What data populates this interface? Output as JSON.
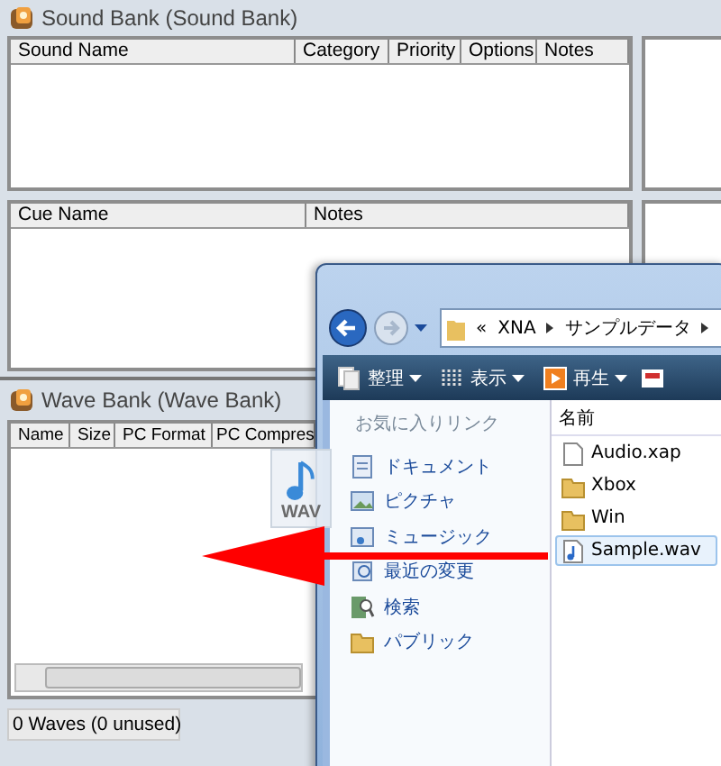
{
  "sound_bank": {
    "title": "Sound Bank (Sound Bank)",
    "sound_columns": [
      "Sound Name",
      "Category",
      "Priority",
      "Options",
      "Notes"
    ],
    "cue_columns": [
      "Cue Name",
      "Notes"
    ]
  },
  "wave_bank": {
    "title": "Wave Bank (Wave Bank)",
    "columns": [
      "Name",
      "Size",
      "PC Format",
      "PC Compres"
    ],
    "status": "0 Waves (0 unused)"
  },
  "explorer": {
    "breadcrumb": [
      "«",
      "XNA",
      "サンプルデータ"
    ],
    "toolbar": [
      {
        "label": "整理",
        "kind": "organize"
      },
      {
        "label": "表示",
        "kind": "views"
      },
      {
        "label": "再生",
        "kind": "play"
      }
    ],
    "favorites_title": "お気に入りリンク",
    "favorites": [
      {
        "label": "ドキュメント",
        "kind": "doc"
      },
      {
        "label": "ピクチャ",
        "kind": "picture"
      },
      {
        "label": "ミュージック",
        "kind": "music"
      },
      {
        "label": "最近の変更",
        "kind": "recent"
      },
      {
        "label": "検索",
        "kind": "search"
      },
      {
        "label": "パブリック",
        "kind": "folder"
      }
    ],
    "column": "名前",
    "files": [
      {
        "name": "Audio.xap",
        "kind": "file",
        "selected": false
      },
      {
        "name": "Xbox",
        "kind": "folder",
        "selected": false
      },
      {
        "name": "Win",
        "kind": "folder",
        "selected": false
      },
      {
        "name": "Sample.wav",
        "kind": "audio",
        "selected": true
      }
    ]
  },
  "drag_icon": {
    "label": "WAV"
  }
}
